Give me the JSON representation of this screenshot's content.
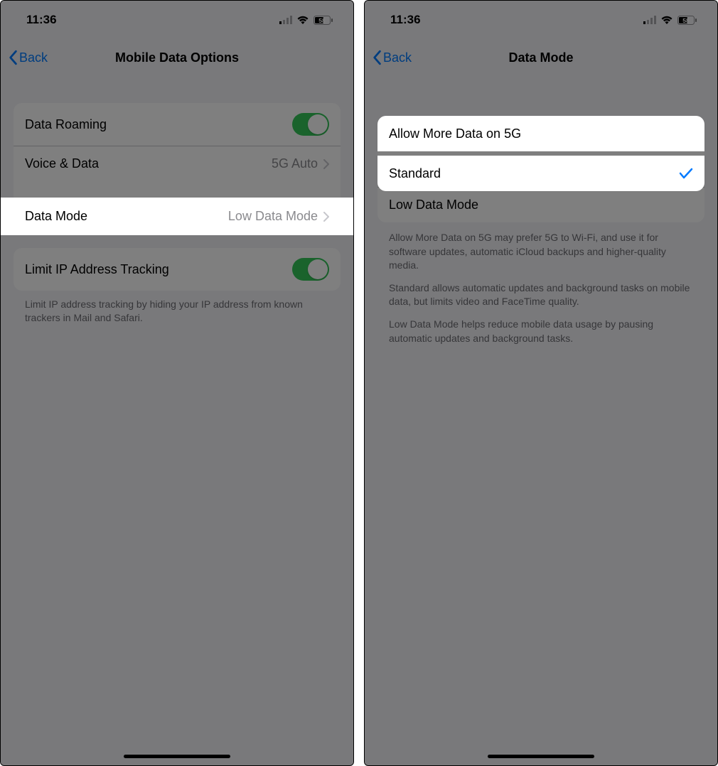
{
  "left": {
    "status": {
      "time": "11:36",
      "battery": "58"
    },
    "nav": {
      "back": "Back",
      "title": "Mobile Data Options"
    },
    "group1": {
      "row0": {
        "label": "Data Roaming"
      },
      "row1": {
        "label": "Voice & Data",
        "value": "5G Auto"
      },
      "row2": {
        "label": "Data Mode",
        "value": "Low Data Mode"
      }
    },
    "group2": {
      "row0": {
        "label": "Limit IP Address Tracking"
      }
    },
    "footer2": "Limit IP address tracking by hiding your IP address from known trackers in Mail and Safari."
  },
  "right": {
    "status": {
      "time": "11:36",
      "battery": "58"
    },
    "nav": {
      "back": "Back",
      "title": "Data Mode"
    },
    "group1": {
      "row0": {
        "label": "Allow More Data on 5G"
      },
      "row1": {
        "label": "Standard"
      },
      "row2": {
        "label": "Low Data Mode"
      }
    },
    "footer_a": "Allow More Data on 5G may prefer 5G to Wi-Fi, and use it for software updates, automatic iCloud backups and higher-quality media.",
    "footer_b": "Standard allows automatic updates and background tasks on mobile data, but limits video and FaceTime quality.",
    "footer_c": "Low Data Mode helps reduce mobile data usage by pausing automatic updates and background tasks."
  }
}
